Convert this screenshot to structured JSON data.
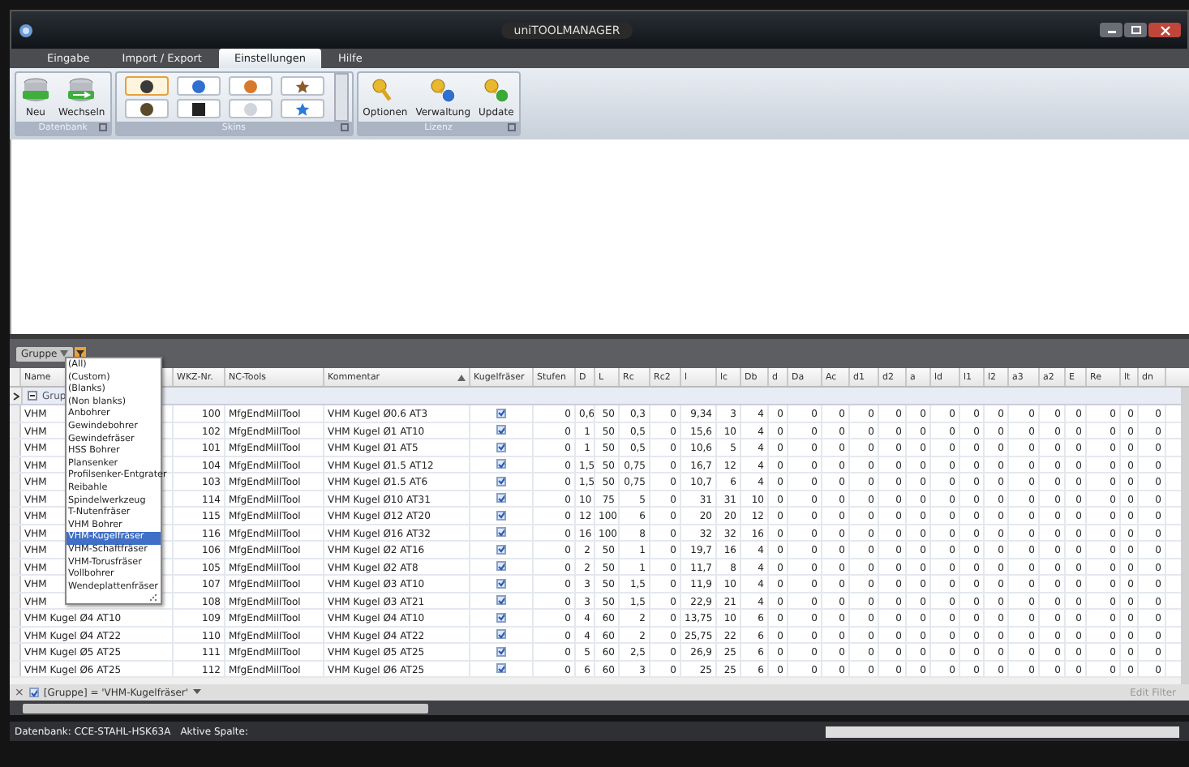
{
  "window": {
    "title": "uniTOOLMANAGER"
  },
  "tabs": [
    {
      "label": "Eingabe",
      "selected": false
    },
    {
      "label": "Import / Export",
      "selected": false
    },
    {
      "label": "Einstellungen",
      "selected": true
    },
    {
      "label": "Hilfe",
      "selected": false
    }
  ],
  "ribbon": {
    "groups": [
      {
        "label": "Datenbank",
        "kind": "buttons",
        "buttons": [
          {
            "label": "Neu"
          },
          {
            "label": "Wechseln"
          }
        ]
      },
      {
        "label": "Skins",
        "kind": "skins",
        "skins": [
          {
            "color": "#3a3a3a",
            "selected": true
          },
          {
            "color": "#2f6fd0",
            "selected": false
          },
          {
            "color": "#d9782a",
            "selected": false
          },
          {
            "color": "#8a5a2a",
            "selected": false
          },
          {
            "color": "#5a4a2a",
            "selected": false
          },
          {
            "color": "#222222",
            "selected": false
          },
          {
            "color": "#d0d4dc",
            "selected": false
          },
          {
            "color": "#2a7ad8",
            "selected": false
          }
        ]
      },
      {
        "label": "Lizenz",
        "kind": "buttons",
        "buttons": [
          {
            "label": "Optionen"
          },
          {
            "label": "Verwaltung"
          },
          {
            "label": "Update"
          }
        ]
      }
    ]
  },
  "group_panel": {
    "chip": "Gruppe"
  },
  "filter_dropdown": {
    "items": [
      {
        "label": "(All)",
        "selected": false
      },
      {
        "label": "(Custom)",
        "selected": false
      },
      {
        "label": "(Blanks)",
        "selected": false
      },
      {
        "label": "(Non blanks)",
        "selected": false
      },
      {
        "label": "Anbohrer",
        "selected": false
      },
      {
        "label": "Gewindebohrer",
        "selected": false
      },
      {
        "label": "Gewindefräser",
        "selected": false
      },
      {
        "label": "HSS Bohrer",
        "selected": false
      },
      {
        "label": "Plansenker",
        "selected": false
      },
      {
        "label": "Profilsenker-Entgrater",
        "selected": false
      },
      {
        "label": "Reibahle",
        "selected": false
      },
      {
        "label": "Spindelwerkzeug",
        "selected": false
      },
      {
        "label": "T-Nutenfräser",
        "selected": false
      },
      {
        "label": "VHM Bohrer",
        "selected": false
      },
      {
        "label": "VHM-Kugelfräser",
        "selected": true
      },
      {
        "label": "VHM-Schaftfräser",
        "selected": false
      },
      {
        "label": "VHM-Torusfräser",
        "selected": false
      },
      {
        "label": "Vollbohrer",
        "selected": false
      },
      {
        "label": "Wendeplattenfräser",
        "selected": false
      }
    ]
  },
  "table": {
    "columns": [
      {
        "label": "Name",
        "kind": "text"
      },
      {
        "label": "WKZ-Nr.",
        "kind": "number"
      },
      {
        "label": "NC-Tools",
        "kind": "text"
      },
      {
        "label": "Kommentar",
        "kind": "text",
        "sorted": true
      },
      {
        "label": "Kugelfräser",
        "kind": "check"
      },
      {
        "label": "Stufen",
        "kind": "number"
      },
      {
        "label": "D",
        "kind": "number"
      },
      {
        "label": "L",
        "kind": "number"
      },
      {
        "label": "Rc",
        "kind": "number"
      },
      {
        "label": "Rc2",
        "kind": "number"
      },
      {
        "label": "l",
        "kind": "number"
      },
      {
        "label": "lc",
        "kind": "number"
      },
      {
        "label": "Db",
        "kind": "number"
      },
      {
        "label": "d",
        "kind": "number"
      },
      {
        "label": "Da",
        "kind": "number"
      },
      {
        "label": "Ac",
        "kind": "number"
      },
      {
        "label": "d1",
        "kind": "number"
      },
      {
        "label": "d2",
        "kind": "number"
      },
      {
        "label": "a",
        "kind": "number"
      },
      {
        "label": "ld",
        "kind": "number"
      },
      {
        "label": "l1",
        "kind": "number"
      },
      {
        "label": "l2",
        "kind": "number"
      },
      {
        "label": "a3",
        "kind": "number"
      },
      {
        "label": "a2",
        "kind": "number"
      },
      {
        "label": "E",
        "kind": "number"
      },
      {
        "label": "Re",
        "kind": "number"
      },
      {
        "label": "lt",
        "kind": "number"
      },
      {
        "label": "dn",
        "kind": "number"
      }
    ],
    "group_row": {
      "label": "Grup",
      "expanded": true
    },
    "rows": [
      {
        "cells": [
          "VHM",
          "100",
          "MfgEndMillTool",
          "VHM Kugel Ø0.6 AT3",
          {
            "checked": true
          },
          "0",
          "0,6",
          "50",
          "0,3",
          "0",
          "9,34",
          "3",
          "4",
          "0",
          "0",
          "0",
          "0",
          "0",
          "0",
          "0",
          "0",
          "0",
          "0",
          "0",
          "0",
          "0",
          "0",
          "0"
        ]
      },
      {
        "cells": [
          "VHM",
          "102",
          "MfgEndMillTool",
          "VHM Kugel Ø1 AT10",
          {
            "checked": true
          },
          "0",
          "1",
          "50",
          "0,5",
          "0",
          "15,6",
          "10",
          "4",
          "0",
          "0",
          "0",
          "0",
          "0",
          "0",
          "0",
          "0",
          "0",
          "0",
          "0",
          "0",
          "0",
          "0",
          "0"
        ]
      },
      {
        "cells": [
          "VHM",
          "101",
          "MfgEndMillTool",
          "VHM Kugel Ø1 AT5",
          {
            "checked": true
          },
          "0",
          "1",
          "50",
          "0,5",
          "0",
          "10,6",
          "5",
          "4",
          "0",
          "0",
          "0",
          "0",
          "0",
          "0",
          "0",
          "0",
          "0",
          "0",
          "0",
          "0",
          "0",
          "0",
          "0"
        ]
      },
      {
        "cells": [
          "VHM",
          "104",
          "MfgEndMillTool",
          "VHM Kugel Ø1.5 AT12",
          {
            "checked": true
          },
          "0",
          "1,5",
          "50",
          "0,75",
          "0",
          "16,7",
          "12",
          "4",
          "0",
          "0",
          "0",
          "0",
          "0",
          "0",
          "0",
          "0",
          "0",
          "0",
          "0",
          "0",
          "0",
          "0",
          "0"
        ]
      },
      {
        "cells": [
          "VHM",
          "103",
          "MfgEndMillTool",
          "VHM Kugel Ø1.5 AT6",
          {
            "checked": true
          },
          "0",
          "1,5",
          "50",
          "0,75",
          "0",
          "10,7",
          "6",
          "4",
          "0",
          "0",
          "0",
          "0",
          "0",
          "0",
          "0",
          "0",
          "0",
          "0",
          "0",
          "0",
          "0",
          "0",
          "0"
        ]
      },
      {
        "cells": [
          "VHM",
          "114",
          "MfgEndMillTool",
          "VHM Kugel Ø10 AT31",
          {
            "checked": true
          },
          "0",
          "10",
          "75",
          "5",
          "0",
          "31",
          "31",
          "10",
          "0",
          "0",
          "0",
          "0",
          "0",
          "0",
          "0",
          "0",
          "0",
          "0",
          "0",
          "0",
          "0",
          "0",
          "0"
        ]
      },
      {
        "cells": [
          "VHM",
          "115",
          "MfgEndMillTool",
          "VHM Kugel Ø12 AT20",
          {
            "checked": true
          },
          "0",
          "12",
          "100",
          "6",
          "0",
          "20",
          "20",
          "12",
          "0",
          "0",
          "0",
          "0",
          "0",
          "0",
          "0",
          "0",
          "0",
          "0",
          "0",
          "0",
          "0",
          "0",
          "0"
        ]
      },
      {
        "cells": [
          "VHM",
          "116",
          "MfgEndMillTool",
          "VHM Kugel Ø16 AT32",
          {
            "checked": true
          },
          "0",
          "16",
          "100",
          "8",
          "0",
          "32",
          "32",
          "16",
          "0",
          "0",
          "0",
          "0",
          "0",
          "0",
          "0",
          "0",
          "0",
          "0",
          "0",
          "0",
          "0",
          "0",
          "0"
        ]
      },
      {
        "cells": [
          "VHM",
          "106",
          "MfgEndMillTool",
          "VHM Kugel Ø2 AT16",
          {
            "checked": true
          },
          "0",
          "2",
          "50",
          "1",
          "0",
          "19,7",
          "16",
          "4",
          "0",
          "0",
          "0",
          "0",
          "0",
          "0",
          "0",
          "0",
          "0",
          "0",
          "0",
          "0",
          "0",
          "0",
          "0"
        ]
      },
      {
        "cells": [
          "VHM",
          "105",
          "MfgEndMillTool",
          "VHM Kugel Ø2 AT8",
          {
            "checked": true
          },
          "0",
          "2",
          "50",
          "1",
          "0",
          "11,7",
          "8",
          "4",
          "0",
          "0",
          "0",
          "0",
          "0",
          "0",
          "0",
          "0",
          "0",
          "0",
          "0",
          "0",
          "0",
          "0",
          "0"
        ]
      },
      {
        "cells": [
          "VHM",
          "107",
          "MfgEndMillTool",
          "VHM Kugel Ø3 AT10",
          {
            "checked": true
          },
          "0",
          "3",
          "50",
          "1,5",
          "0",
          "11,9",
          "10",
          "4",
          "0",
          "0",
          "0",
          "0",
          "0",
          "0",
          "0",
          "0",
          "0",
          "0",
          "0",
          "0",
          "0",
          "0",
          "0"
        ]
      },
      {
        "cells": [
          "VHM",
          "108",
          "MfgEndMillTool",
          "VHM Kugel Ø3 AT21",
          {
            "checked": true
          },
          "0",
          "3",
          "50",
          "1,5",
          "0",
          "22,9",
          "21",
          "4",
          "0",
          "0",
          "0",
          "0",
          "0",
          "0",
          "0",
          "0",
          "0",
          "0",
          "0",
          "0",
          "0",
          "0",
          "0"
        ]
      },
      {
        "cells": [
          "VHM Kugel Ø4 AT10",
          "109",
          "MfgEndMillTool",
          "VHM Kugel Ø4 AT10",
          {
            "checked": true
          },
          "0",
          "4",
          "60",
          "2",
          "0",
          "13,75",
          "10",
          "6",
          "0",
          "0",
          "0",
          "0",
          "0",
          "0",
          "0",
          "0",
          "0",
          "0",
          "0",
          "0",
          "0",
          "0",
          "0"
        ]
      },
      {
        "cells": [
          "VHM Kugel Ø4 AT22",
          "110",
          "MfgEndMillTool",
          "VHM Kugel Ø4 AT22",
          {
            "checked": true
          },
          "0",
          "4",
          "60",
          "2",
          "0",
          "25,75",
          "22",
          "6",
          "0",
          "0",
          "0",
          "0",
          "0",
          "0",
          "0",
          "0",
          "0",
          "0",
          "0",
          "0",
          "0",
          "0",
          "0"
        ]
      },
      {
        "cells": [
          "VHM Kugel Ø5 AT25",
          "111",
          "MfgEndMillTool",
          "VHM Kugel Ø5 AT25",
          {
            "checked": true
          },
          "0",
          "5",
          "60",
          "2,5",
          "0",
          "26,9",
          "25",
          "6",
          "0",
          "0",
          "0",
          "0",
          "0",
          "0",
          "0",
          "0",
          "0",
          "0",
          "0",
          "0",
          "0",
          "0",
          "0"
        ]
      },
      {
        "cells": [
          "VHM Kugel Ø6 AT25",
          "112",
          "MfgEndMillTool",
          "VHM Kugel Ø6 AT25",
          {
            "checked": true
          },
          "0",
          "6",
          "60",
          "3",
          "0",
          "25",
          "25",
          "6",
          "0",
          "0",
          "0",
          "0",
          "0",
          "0",
          "0",
          "0",
          "0",
          "0",
          "0",
          "0",
          "0",
          "0",
          "0"
        ]
      }
    ]
  },
  "filter_bar": {
    "close": "×",
    "enabled": true,
    "expression": "[Gruppe] = 'VHM-Kugelfräser'",
    "edit": "Edit Filter"
  },
  "status_bar": {
    "database": "Datenbank: CCE-STAHL-HSK63A",
    "active_column": "Aktive Spalte:"
  }
}
